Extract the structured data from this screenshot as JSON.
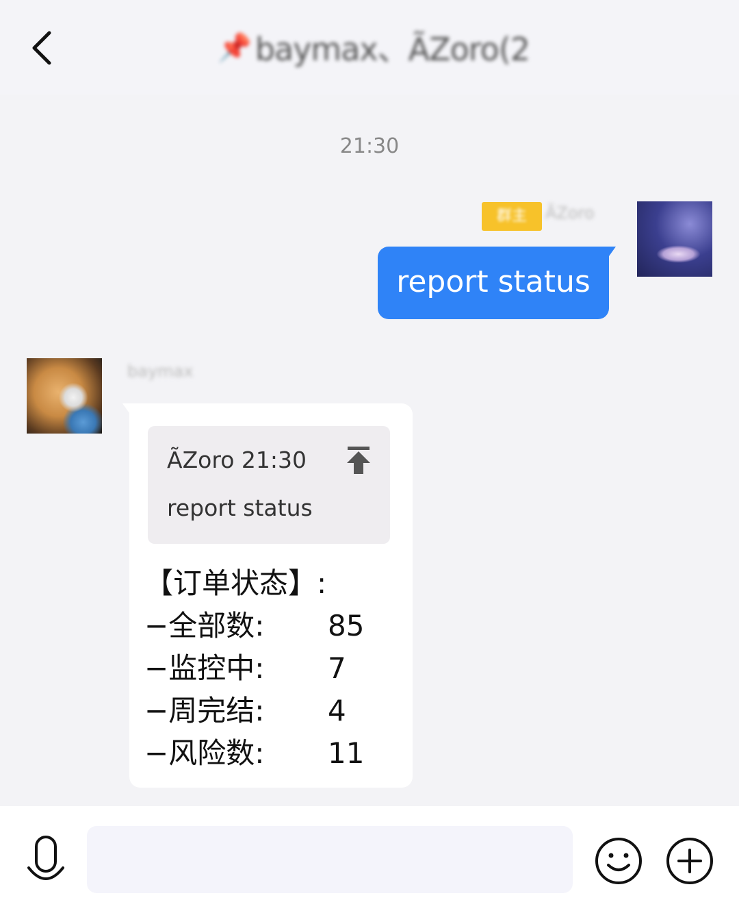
{
  "header": {
    "back_icon": "chevron-left-icon",
    "pin_icon": "pin-icon",
    "title": "baymax、ÃZoro(2)"
  },
  "chat": {
    "timestamp": "21:30",
    "outgoing": {
      "badge": "群主",
      "sender": "ÃZoro",
      "text": "report status"
    },
    "incoming": {
      "sender": "baymax",
      "quote": {
        "header": "ÃZoro 21:30",
        "text": "report status",
        "icon": "scroll-to-top-icon"
      },
      "status_title": "【订单状态】:",
      "status_rows": [
        {
          "label": "−全部数:",
          "value": "85"
        },
        {
          "label": "−监控中:",
          "value": "7"
        },
        {
          "label": "−周完结:",
          "value": "4"
        },
        {
          "label": "−风险数:",
          "value": "11"
        }
      ]
    }
  },
  "input_bar": {
    "placeholder": "",
    "voice_icon": "microphone-icon",
    "emoji_icon": "smiley-icon",
    "more_icon": "plus-circle-icon"
  },
  "colors": {
    "accent": "#2f83f7",
    "badge": "#f7c22a",
    "background": "#f3f3f6"
  }
}
